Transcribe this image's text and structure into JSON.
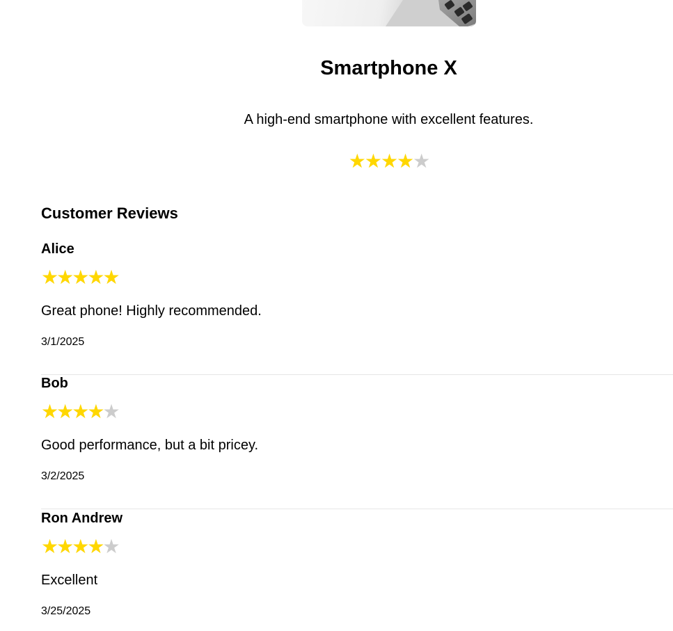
{
  "product": {
    "title": "Smartphone X",
    "description": "A high-end smartphone with excellent features.",
    "rating": 4,
    "max_rating": 5
  },
  "reviews_section": {
    "heading": "Customer Reviews",
    "reviews": [
      {
        "author": "Alice",
        "rating": 5,
        "text": "Great phone! Highly recommended.",
        "date": "3/1/2025"
      },
      {
        "author": "Bob",
        "rating": 4,
        "text": "Good performance, but a bit pricey.",
        "date": "3/2/2025"
      },
      {
        "author": "Ron Andrew",
        "rating": 4,
        "text": "Excellent",
        "date": "3/25/2025"
      }
    ]
  },
  "colors": {
    "star_filled": "#ffd700",
    "star_empty": "#cccccc",
    "divider": "#e6e6e6"
  }
}
